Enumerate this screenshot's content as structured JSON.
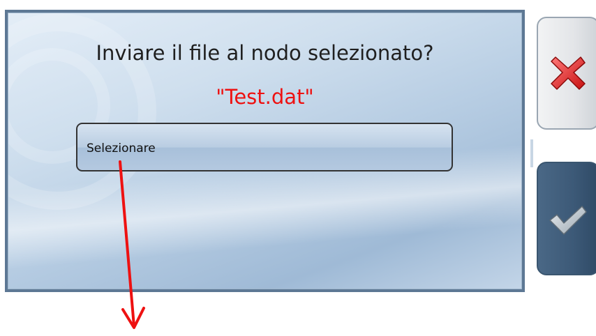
{
  "dialog": {
    "question": "Inviare il file al nodo selezionato?",
    "filename": "\"Test.dat\"",
    "node_select": {
      "label": "Selezionare"
    }
  },
  "side_buttons": {
    "cancel_icon": "red-x-icon",
    "confirm_icon": "checkmark-icon"
  },
  "colors": {
    "filename_text": "#ee1111",
    "annotation_arrow": "#ee1111",
    "confirm_button": "#3c5977"
  }
}
